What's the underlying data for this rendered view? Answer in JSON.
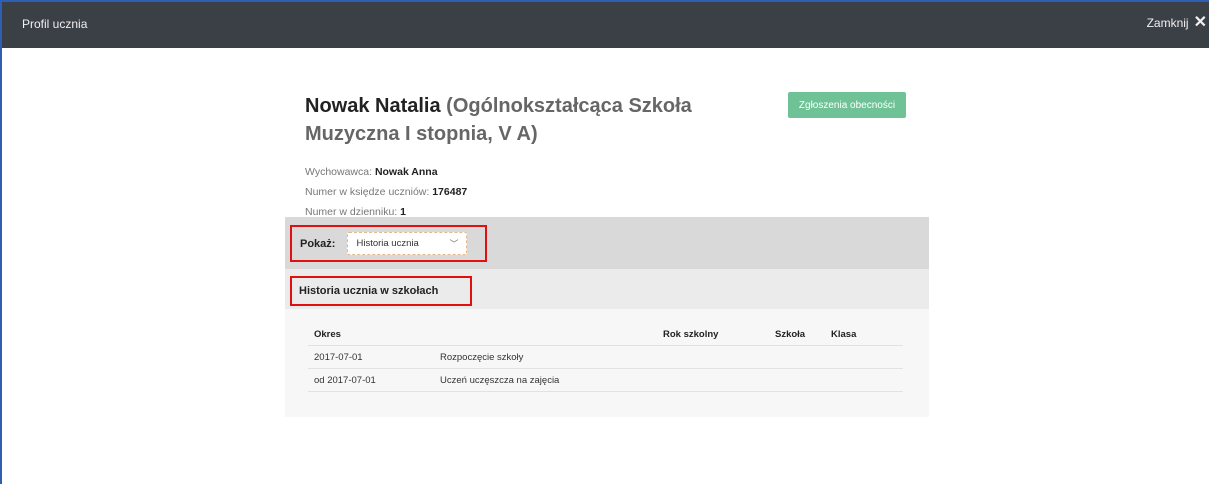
{
  "window": {
    "title": "Profil ucznia",
    "close_label": "Zamknij",
    "close_icon": "close-icon"
  },
  "student": {
    "name": "Nowak Natalia",
    "school_class": "(Ogólnokształcąca Szkoła Muzyczna I stopnia, V A)",
    "tutor_label": "Wychowawca:",
    "tutor": "Nowak Anna",
    "book_number_label": "Numer w księdze uczniów:",
    "book_number": "176487",
    "register_number_label": "Numer w dzienniku:",
    "register_number": "1"
  },
  "actions": {
    "attendance_button": "Zgłoszenia obecności"
  },
  "filter": {
    "label": "Pokaż:",
    "selected": "Historia ucznia"
  },
  "section": {
    "title": "Historia ucznia w szkołach"
  },
  "table": {
    "headers": {
      "okres": "Okres",
      "rok": "Rok szkolny",
      "szkola": "Szkoła",
      "klasa": "Klasa"
    },
    "rows": [
      {
        "okres": "2017-07-01",
        "desc": "Rozpoczęcie szkoły",
        "rok": "",
        "szkola": "",
        "klasa": ""
      },
      {
        "okres": "od 2017-07-01",
        "desc": "Uczeń uczęszcza na zajęcia",
        "rok": "",
        "szkola": "",
        "klasa": ""
      }
    ]
  },
  "colors": {
    "topbar": "#3b3f46",
    "accent_button": "#6fc296",
    "highlight_border": "#e01010"
  }
}
